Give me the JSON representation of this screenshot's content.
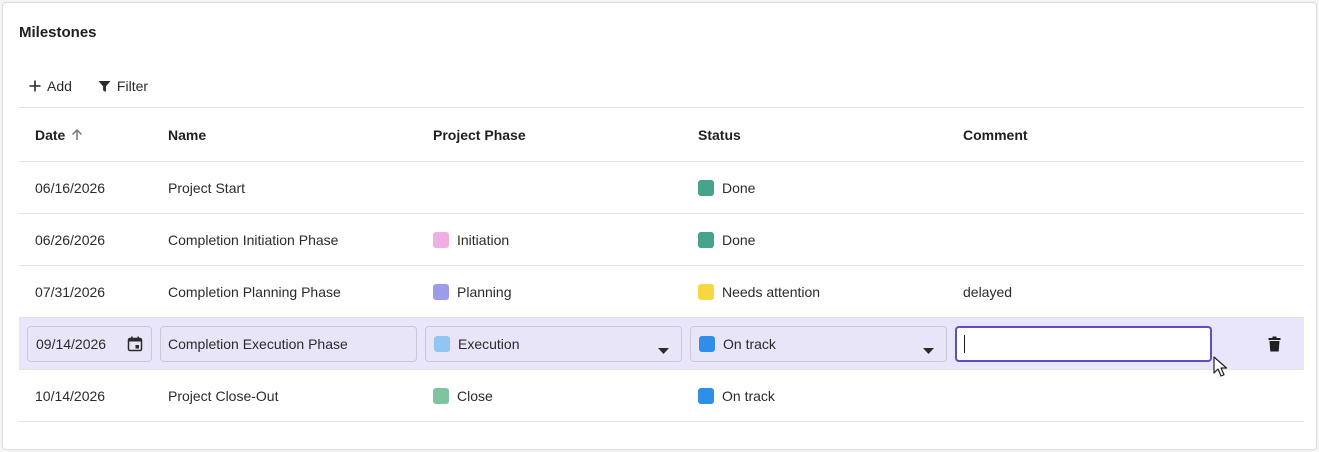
{
  "title": "Milestones",
  "toolbar": {
    "add_label": "Add",
    "filter_label": "Filter"
  },
  "columns": {
    "date": "Date",
    "name": "Name",
    "phase": "Project Phase",
    "status": "Status",
    "comment": "Comment"
  },
  "colors": {
    "done": "#45a38a",
    "needs_attention": "#f7d641",
    "on_track": "#2f8fe8",
    "initiation": "#f2aee0",
    "planning": "#9c9ce8",
    "execution": "#90c6f2",
    "close": "#7ec4a0",
    "edit_row_bg": "#e9e6fb",
    "focus_border": "#5b4fc4"
  },
  "rows": [
    {
      "date": "06/16/2026",
      "name": "Project Start",
      "phase": "",
      "status": "Done",
      "comment": ""
    },
    {
      "date": "06/26/2026",
      "name": "Completion Initiation Phase",
      "phase": "Initiation",
      "status": "Done",
      "comment": ""
    },
    {
      "date": "07/31/2026",
      "name": "Completion Planning Phase",
      "phase": "Planning",
      "status": "Needs attention",
      "comment": "delayed"
    },
    {
      "date": "09/14/2026",
      "name": "Completion Execution Phase",
      "phase": "Execution",
      "status": "On track",
      "comment": ""
    },
    {
      "date": "10/14/2026",
      "name": "Project Close-Out",
      "phase": "Close",
      "status": "On track",
      "comment": ""
    }
  ],
  "icons": {
    "add": "plus-icon",
    "filter": "filter-icon",
    "sort": "arrow-up-icon",
    "calendar": "calendar-icon",
    "dropdown": "caret-down-icon",
    "delete": "trash-icon",
    "cursor": "mouse-pointer-icon"
  }
}
